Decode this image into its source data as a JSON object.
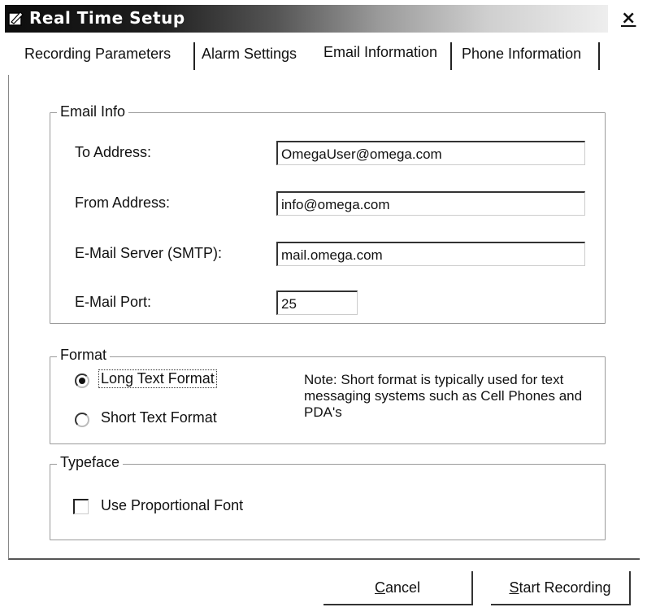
{
  "window": {
    "title": "Real Time Setup",
    "close_label": "×"
  },
  "tabs": [
    {
      "label": "Recording Parameters",
      "active": false
    },
    {
      "label": "Alarm Settings",
      "active": false
    },
    {
      "label": "Email Information",
      "active": true
    },
    {
      "label": "Phone Information",
      "active": false
    }
  ],
  "email_info": {
    "group_label": "Email Info",
    "to_label": "To Address:",
    "to_value": "OmegaUser@omega.com",
    "from_label": "From Address:",
    "from_value": "info@omega.com",
    "server_label": "E-Mail Server (SMTP):",
    "server_value": "mail.omega.com",
    "port_label": "E-Mail Port:",
    "port_value": "25"
  },
  "format": {
    "group_label": "Format",
    "long_label": "Long Text Format",
    "short_label": "Short Text Format",
    "selected": "long",
    "note": "Note: Short format is typically used for text messaging systems such as Cell Phones and PDA's"
  },
  "typeface": {
    "group_label": "Typeface",
    "proportional_label": "Use Proportional Font",
    "proportional_checked": false
  },
  "buttons": {
    "cancel_prefix": "C",
    "cancel_rest": "ancel",
    "start_prefix": "S",
    "start_rest": "tart Recording"
  }
}
